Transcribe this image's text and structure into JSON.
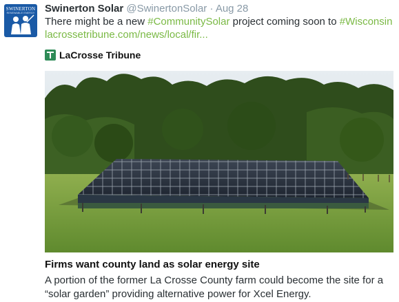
{
  "avatar": {
    "brand": "SWINERTON",
    "subtitle": "RENEWABLE ENERGY"
  },
  "tweet": {
    "author_name": "Swinerton Solar",
    "author_handle": "@SwinertonSolar",
    "separator": "·",
    "date": "Aug 28",
    "text_part1": "There might be a new ",
    "hashtag1": "#CommunitySolar",
    "text_part2": " project coming soon to ",
    "hashtag2": "#Wisconsin",
    "link": "lacrossetribune.com/news/local/fir..."
  },
  "card": {
    "source": "LaCrosse Tribune",
    "title": "Firms want county land as solar energy site",
    "description": "A portion of the former La Crosse County farm could become the site for a “solar garden” providing alternative power for Xcel Energy."
  },
  "colors": {
    "hashtag": "#7ab944",
    "muted": "#8899a6",
    "brand_blue": "#1a5aa6"
  },
  "icons": {
    "source_logo": "tribune-logo-icon"
  }
}
